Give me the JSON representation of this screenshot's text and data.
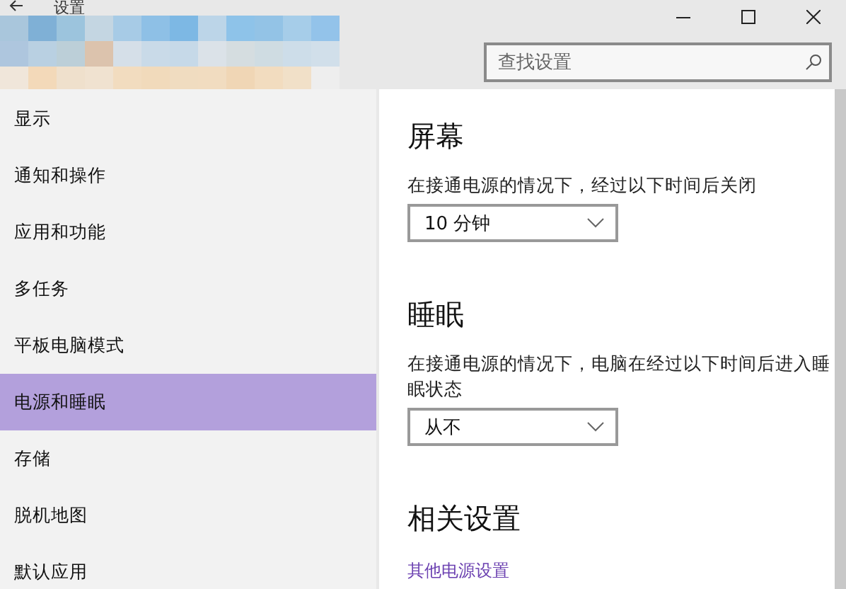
{
  "window": {
    "title": "设置"
  },
  "search": {
    "placeholder": "查找设置"
  },
  "sidebar": {
    "items": [
      {
        "label": "显示",
        "selected": false
      },
      {
        "label": "通知和操作",
        "selected": false
      },
      {
        "label": "应用和功能",
        "selected": false
      },
      {
        "label": "多任务",
        "selected": false
      },
      {
        "label": "平板电脑模式",
        "selected": false
      },
      {
        "label": "电源和睡眠",
        "selected": true
      },
      {
        "label": "存储",
        "selected": false
      },
      {
        "label": "脱机地图",
        "selected": false
      },
      {
        "label": "默认应用",
        "selected": false
      }
    ]
  },
  "sections": [
    {
      "heading": "屏幕",
      "description": "在接通电源的情况下，经过以下时间后关闭",
      "dropdown": "10 分钟"
    },
    {
      "heading": "睡眠",
      "description": "在接通电源的情况下，电脑在经过以下时间后进入睡眠状态",
      "dropdown": "从不"
    }
  ],
  "related": {
    "heading": "相关设置",
    "link": "其他电源设置"
  }
}
